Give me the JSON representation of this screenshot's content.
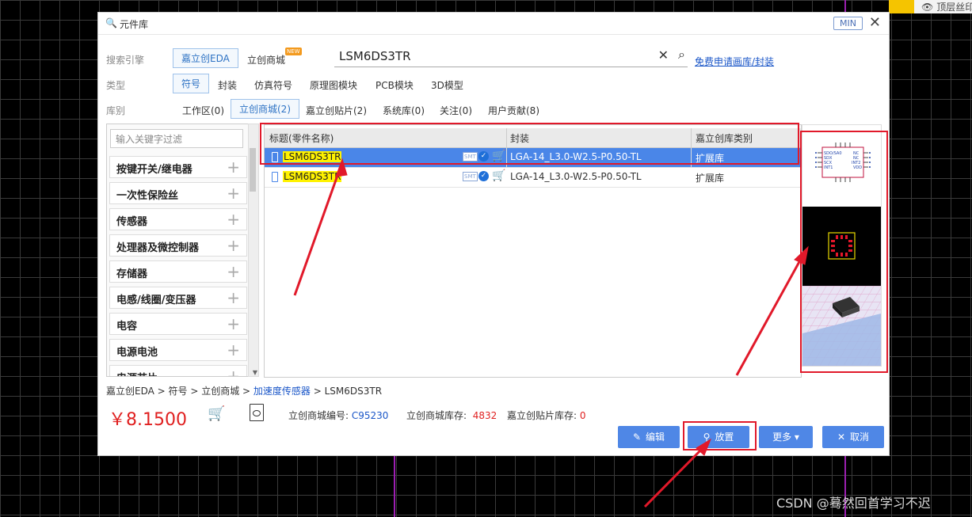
{
  "background": {
    "layer_label": "顶层丝印"
  },
  "dialog": {
    "title": "元件库",
    "min_label": "MIN",
    "close_symbol": "✕",
    "engine": {
      "label": "搜索引擎",
      "options": [
        "嘉立创EDA",
        "立创商城"
      ],
      "new_badge": "NEW"
    },
    "search": {
      "value": "LSM6DS3TR",
      "apply_link": "免费申请画库/封装"
    },
    "type": {
      "label": "类型",
      "options": [
        "符号",
        "封装",
        "仿真符号",
        "原理图模块",
        "PCB模块",
        "3D模型"
      ]
    },
    "library": {
      "label": "库别",
      "options": [
        "工作区(0)",
        "立创商城(2)",
        "嘉立创贴片(2)",
        "系统库(0)",
        "关注(0)",
        "用户贡献(8)"
      ]
    },
    "filter_placeholder": "输入关键字过滤",
    "categories": [
      "按键开关/继电器",
      "一次性保险丝",
      "传感器",
      "处理器及微控制器",
      "存储器",
      "电感/线圈/变压器",
      "电容",
      "电源电池",
      "电源芯片"
    ],
    "table": {
      "headers": [
        "标题(零件名称)",
        "封装",
        "嘉立创库类别"
      ],
      "rows": [
        {
          "title": "LSM6DS3TR",
          "smt": "SMT",
          "footprint": "LGA-14_L3.0-W2.5-P0.50-TL",
          "lib_type": "扩展库"
        },
        {
          "title": "LSM6DS3TR",
          "smt": "SMT",
          "footprint": "LGA-14_L3.0-W2.5-P0.50-TL",
          "lib_type": "扩展库"
        }
      ]
    },
    "preview": {
      "symbol_pins_left": [
        "SDO/SA0",
        "SDX",
        "SCX",
        "INT1"
      ],
      "symbol_pins_right": [
        "NC",
        "NC",
        "INT2",
        "VDD"
      ]
    },
    "breadcrumb": {
      "parts": [
        "嘉立创EDA",
        "符号",
        "立创商城"
      ],
      "link": "加速度传感器",
      "last": "LSM6DS3TR",
      "sep": " > "
    },
    "price": "￥8.1500",
    "info": {
      "code_label": "立创商城编号:",
      "code": "C95230",
      "stock_label": "立创商城库存:",
      "stock": "4832",
      "smt_stock_label": "嘉立创贴片库存:",
      "smt_stock": "0"
    },
    "buttons": {
      "edit": "编辑",
      "place": "放置",
      "more": "更多",
      "cancel": "取消"
    }
  },
  "watermark": "CSDN @蓦然回首学习不迟",
  "colors": {
    "accent": "#4f87e6",
    "selected_row": "#4a86e8",
    "annotation_red": "#e1192a",
    "price_red": "#e02020",
    "highlight_yellow": "#fff200"
  }
}
